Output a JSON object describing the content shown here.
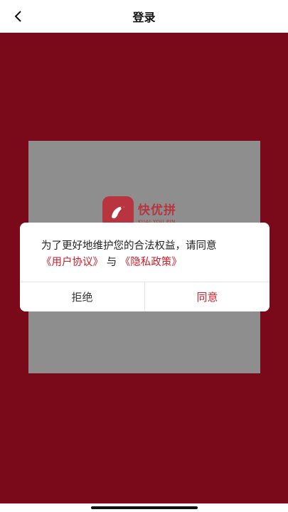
{
  "header": {
    "title": "登录"
  },
  "logo": {
    "brand_cn": "快优拼",
    "brand_en": "KUAI YOU PIN"
  },
  "dialog": {
    "message": "为了更好地维护您的合法权益，请同意",
    "user_agreement_link": "《用户协议》",
    "connector": "与",
    "privacy_policy_link": "《隐私政策》",
    "reject_label": "拒绝",
    "agree_label": "同意"
  },
  "colors": {
    "background": "#7a0a1a",
    "accent": "#c8202c",
    "card_gray": "#8e8e8e"
  },
  "icons": {
    "back": "chevron-left-icon",
    "logo": "app-logo-icon"
  }
}
